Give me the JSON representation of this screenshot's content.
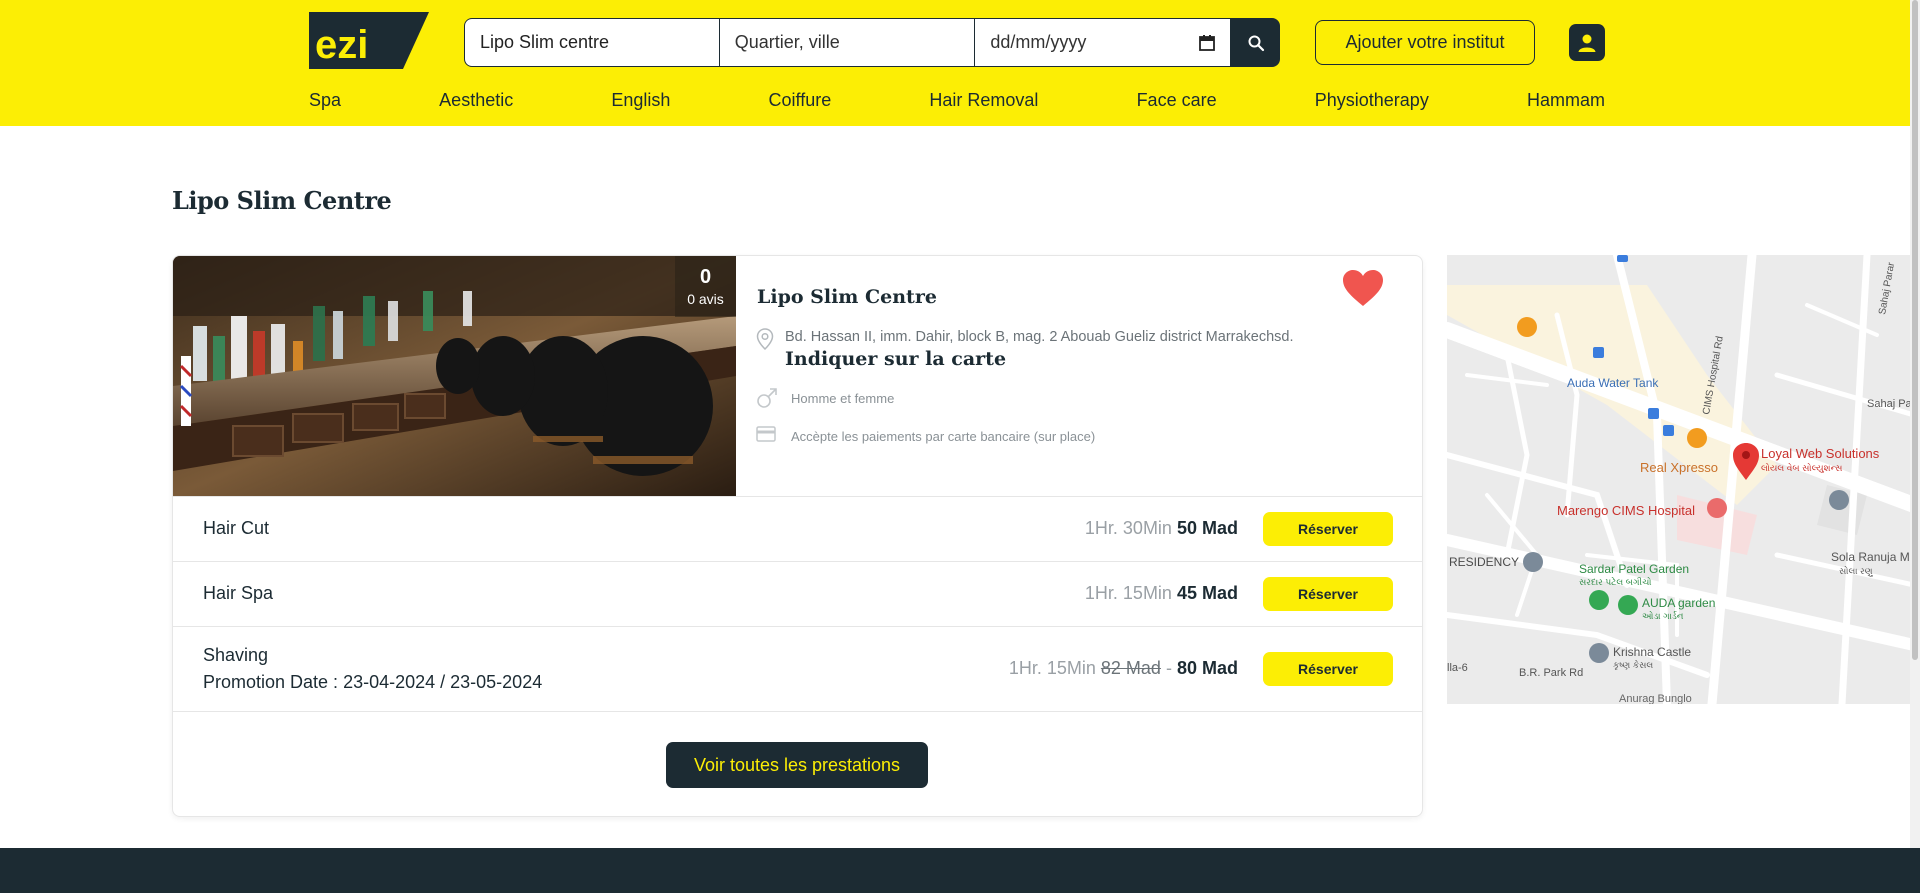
{
  "header": {
    "logo_text": "ezi",
    "search_salon_value": "Lipo Slim centre",
    "search_location_placeholder": "Quartier, ville",
    "search_date_placeholder": "dd/mm/yyyy",
    "add_institute_label": "Ajouter votre institut"
  },
  "nav": [
    "Spa",
    "Aesthetic",
    "English",
    "Coiffure",
    "Hair Removal",
    "Face care",
    "Physiotherapy",
    "Hammam"
  ],
  "page_title": "Lipo Slim Centre",
  "salon": {
    "rating_count": "0",
    "rating_label": "0 avis",
    "name": "Lipo Slim Centre",
    "address": "Bd. Hassan II, imm. Dahir, block B, mag. 2 Abouab Gueliz district Marrakechsd.",
    "map_link": "Indiquer sur la carte",
    "gender": "Homme et femme",
    "payment": "Accèpte les paiements par carte bancaire (sur place)"
  },
  "services": [
    {
      "name": "Hair Cut",
      "promo": "",
      "duration": "1Hr. 30Min",
      "old_price": "",
      "price": "50 Mad",
      "button": "Réserver"
    },
    {
      "name": "Hair Spa",
      "promo": "",
      "duration": "1Hr. 15Min",
      "old_price": "",
      "price": "45 Mad",
      "button": "Réserver"
    },
    {
      "name": "Shaving",
      "promo": "Promotion Date : 23-04-2024 / 23-05-2024",
      "duration": "1Hr. 15Min",
      "old_price": "82 Mad",
      "price": "80 Mad",
      "button": "Réserver"
    }
  ],
  "see_all_label": "Voir toutes les prestations",
  "map": {
    "labels": {
      "auda_water_tank": "Auda Water Tank",
      "real_xpresso": "Real Xpresso",
      "loyal_web": "Loyal Web Solutions",
      "loyal_web_sub": "લોયલ વેબ સોલ્યુશન્સ",
      "marengo": "Marengo CIMS Hospital",
      "cims_road": "CIMS Hospital Rd",
      "residency": "RESIDENCY",
      "sardar": "Sardar Patel Garden",
      "sardar_sub": "સરદાર પટેલ બગીચો",
      "auda_garden": "AUDA garden",
      "auda_garden_sub": "ઓડા ગાર્ડન",
      "krishna": "Krishna Castle",
      "krishna_sub": "કૃષ્ણ કેસલ",
      "bright": "B.R. Park Rd",
      "anurag": "Anurag Bunglo",
      "sola": "Sola Ranuja M",
      "sola_sub": "સોલા રણુ",
      "sahaj": "Sahaj Pa",
      "sahaj2": "Sahaj Parar",
      "villa": "lla-6"
    }
  },
  "colors": {
    "brand_yellow": "#fcee05",
    "dark": "#1c2b33",
    "heart": "#f0554f",
    "pin": "#e53935"
  }
}
